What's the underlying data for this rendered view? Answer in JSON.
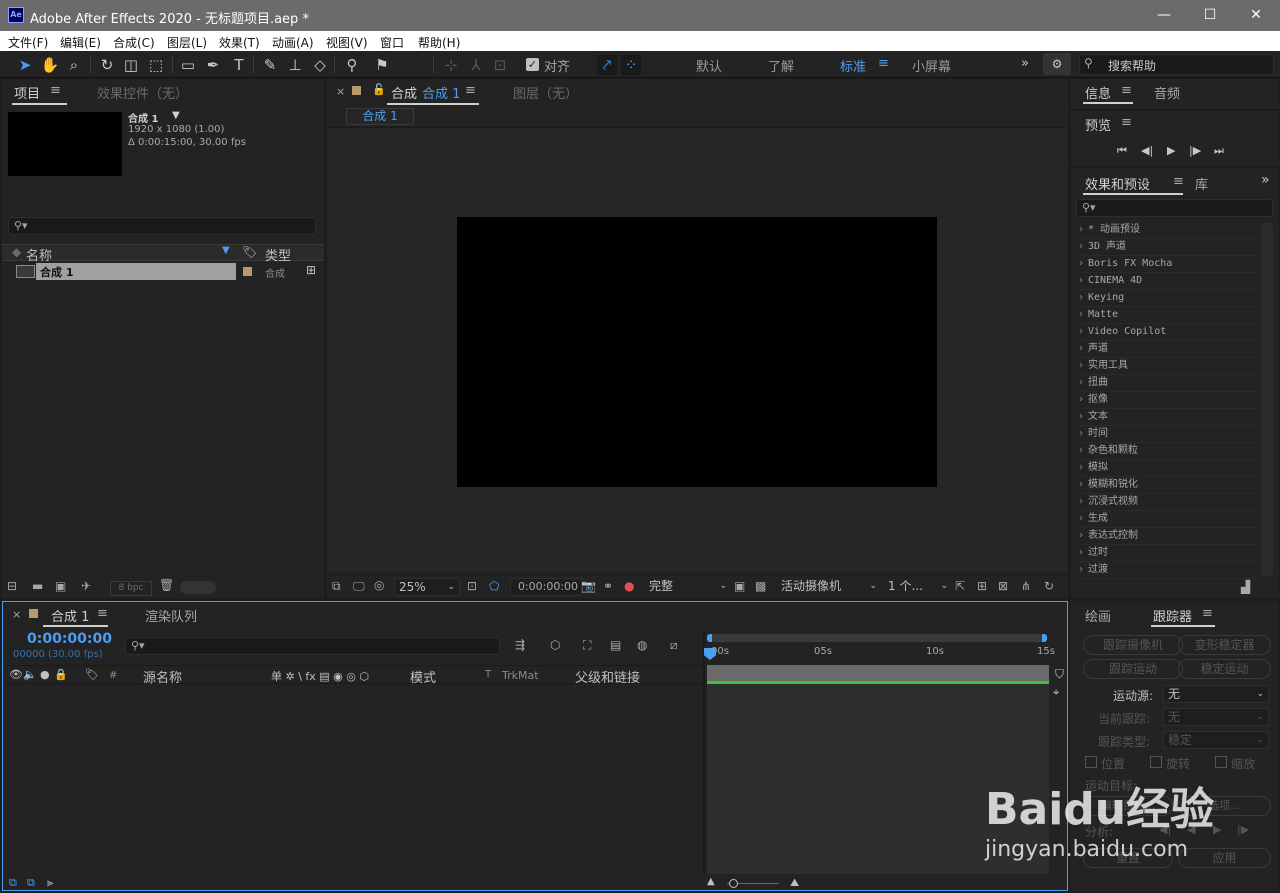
{
  "app": {
    "window_title": "Adobe After Effects 2020 - 无标题项目.aep *",
    "logo_text": "Ae",
    "window_controls": [
      "minimize-icon",
      "maximize-icon",
      "close-icon"
    ]
  },
  "menu": [
    "文件(F)",
    "编辑(E)",
    "合成(C)",
    "图层(L)",
    "效果(T)",
    "动画(A)",
    "视图(V)",
    "窗口",
    "帮助(H)"
  ],
  "toolbar": {
    "snap_label": "对齐",
    "workspaces": [
      "默认",
      "了解",
      "标准",
      "小屏幕"
    ],
    "active_workspace": "标准",
    "search_help_placeholder": "搜索帮助",
    "more_glyph": "»"
  },
  "project_panel": {
    "tab_project": "项目",
    "tab_effect_controls": "效果控件（无）",
    "comp_name": "合成 1",
    "comp_dims": "1920 x 1080 (1.00)",
    "comp_duration": "Δ 0:00:15:00, 30.00 fps",
    "col_name": "名称",
    "col_type": "类型",
    "items": [
      {
        "name": "合成 1",
        "type": "合成"
      }
    ],
    "bpc": "8 bpc"
  },
  "comp_panel": {
    "tab_prefix": "合成",
    "tab_comp_name": "合成 1",
    "tab_layer": "图层（无）",
    "breadcrumb": "合成 1",
    "zoom": "25%",
    "timecode": "0:00:00:00",
    "resolution": "完整",
    "camera": "活动摄像机",
    "views": "1 个...",
    "background_color": "#000000"
  },
  "right_panel": {
    "tab_info": "信息",
    "tab_audio": "音频",
    "tab_preview": "预览",
    "tab_effects": "效果和预设",
    "tab_library": "库",
    "effects": [
      "* 动画预设",
      "3D 声道",
      "Boris FX Mocha",
      "CINEMA 4D",
      "Keying",
      "Matte",
      "Video Copilot",
      "声道",
      "实用工具",
      "扭曲",
      "抠像",
      "文本",
      "时间",
      "杂色和颗粒",
      "模拟",
      "模糊和锐化",
      "沉浸式视频",
      "生成",
      "表达式控制",
      "过时",
      "过渡"
    ]
  },
  "timeline": {
    "tab_comp": "合成 1",
    "tab_render": "渲染队列",
    "timecode": "0:00:00:00",
    "frame_info": "00000 (30.00 fps)",
    "col_num": "#",
    "col_source": "源名称",
    "col_switches": "单 ✲ \\ fx ▤ ◉ ◎ ⬡",
    "col_mode": "模式",
    "col_t": "T",
    "col_trkmat": "TrkMat",
    "col_parent": "父级和链接",
    "ruler": [
      "00s",
      "05s",
      "10s",
      "15s"
    ]
  },
  "tracker": {
    "tab_paint": "绘画",
    "tab_tracker": "跟踪器",
    "btn_track_camera": "跟踪摄像机",
    "btn_warp_stabilize": "变形稳定器",
    "btn_track_motion": "跟踪运动",
    "btn_stabilize_motion": "稳定运动",
    "motion_source_label": "运动源:",
    "motion_source_value": "无",
    "current_track_label": "当前跟踪:",
    "current_track_value": "无",
    "track_type_label": "跟踪类型:",
    "track_type_value": "稳定",
    "cb_position": "位置",
    "cb_rotation": "旋转",
    "cb_scale": "缩放",
    "motion_target": "运动目标:",
    "edit_target": "编辑目标...",
    "options": "选项...",
    "analyze": "分析:",
    "reset": "重置",
    "apply": "应用"
  },
  "watermark": {
    "brand": "Baidu经验",
    "url": "jingyan.baidu.com"
  }
}
